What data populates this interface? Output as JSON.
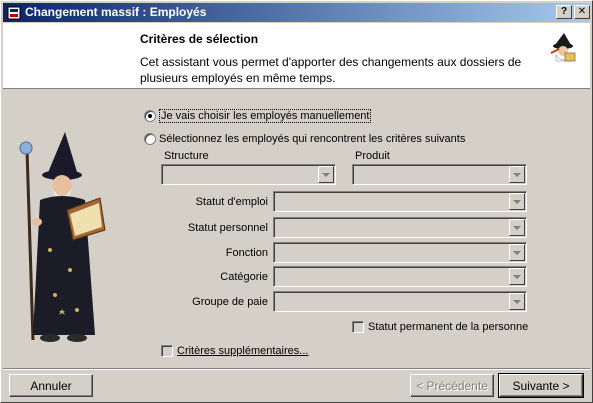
{
  "window": {
    "title": "Changement massif : Employés",
    "help_label": "?",
    "close_label": "✕"
  },
  "header": {
    "title": "Critères de sélection",
    "description": "Cet assistant vous permet d'apporter des changements aux dossiers de plusieurs employés en même temps."
  },
  "selection": {
    "manual_label": "Je vais choisir les employés manuellement",
    "criteria_label": "Sélectionnez les employés qui rencontrent les critères suivants",
    "manual_checked": true
  },
  "criteria": {
    "structure_label": "Structure",
    "produit_label": "Produit",
    "fields": [
      {
        "label": "Statut d'emploi"
      },
      {
        "label": "Statut personnel"
      },
      {
        "label": "Fonction"
      },
      {
        "label": "Catégorie"
      },
      {
        "label": "Groupe de paie"
      }
    ],
    "permanent_label": "Statut permanent de la personne",
    "extra_label": "Critères supplémentaires..."
  },
  "footer": {
    "cancel_label": "Annuler",
    "previous_label": "< Précédente",
    "next_label": "Suivante >"
  },
  "colors": {
    "titlebar_start": "#0a246a",
    "titlebar_end": "#a6caf0",
    "face": "#d4d0c8"
  }
}
